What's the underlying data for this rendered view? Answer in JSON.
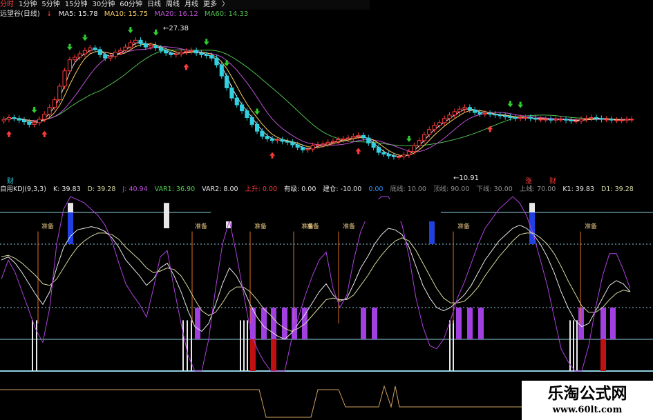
{
  "toolbar": {
    "tabs": [
      "分时",
      "1分钟",
      "5分钟",
      "15分钟",
      "30分钟",
      "60分钟",
      "日线",
      "周线",
      "月线",
      "更多",
      "〉"
    ],
    "active_index": 0
  },
  "stock_header": {
    "name": "远望谷(日线)",
    "ma5": "MA5: 15.78",
    "ma10": "MA10: 15.75",
    "ma20": "MA20: 16.12",
    "ma60": "MA60: 14.33",
    "up_arrow": "↑",
    "down_arrow": "↓"
  },
  "price_labels": {
    "high": "27.38",
    "low": "10.91",
    "tag_cai_left": "财",
    "tag_zhang": "涨",
    "tag_cai_right": "财"
  },
  "kdj_header": {
    "name": "自用KDJ(9,3,3)",
    "k": "K: 39.83",
    "d": "D: 39.28",
    "j": "J: 40.94",
    "var1": "VAR1: 36.90",
    "var2": "VAR2: 8.00",
    "shangsheng": "上升: 0.00",
    "youxi": "有级: 0.00",
    "jiancang": "建仓: -10.00",
    "zero": "0.00",
    "dixian": "底线: 10.00",
    "dingxian": "顶线: 90.00",
    "xiaxian": "下线: 30.00",
    "shangxian": "上线: 70.00",
    "k1": "K1: 39.83",
    "d1": "D1: 39.28"
  },
  "marker_text": "准备",
  "watermark": {
    "title": "乐淘公式网",
    "url": "www.60lt.com"
  },
  "colors": {
    "up": "#ff3c3c",
    "up_candle": "#ff3c3c",
    "down_candle": "#31d0e0",
    "ma5": "#e8e8e8",
    "ma10": "#ffd060",
    "ma20": "#c050d8",
    "ma60": "#50c050",
    "kdj_k": "#e8e8e8",
    "kdj_d": "#d8d8a0",
    "kdj_j": "#b040e0",
    "purple_bar": "#a040e0",
    "blue_bar": "#2040e0",
    "white_bar": "#e8e8e8",
    "red_bar": "#c01010",
    "orange": "#e07020",
    "level": "#90d0e0",
    "square_wave": "#d0a060"
  },
  "chart_data": [
    {
      "type": "candlestick",
      "title": "远望谷(日线)",
      "ylim": [
        10.0,
        28.5
      ],
      "x": [
        1,
        2,
        3,
        4,
        5,
        6,
        7,
        8,
        9,
        10,
        11,
        12,
        13,
        14,
        15,
        16,
        17,
        18,
        19,
        20,
        21,
        22,
        23,
        24,
        25,
        26,
        27,
        28,
        29,
        30,
        31,
        32,
        33,
        34,
        35,
        36,
        37,
        38,
        39,
        40,
        41,
        42,
        43,
        44,
        45,
        46,
        47,
        48,
        49,
        50,
        51,
        52,
        53,
        54,
        55,
        56,
        57,
        58,
        59,
        60,
        61,
        62,
        63,
        64,
        65,
        66,
        67,
        68,
        69,
        70,
        71,
        72,
        73,
        74,
        75,
        76,
        77,
        78,
        79,
        80,
        81,
        82,
        83,
        84,
        85,
        86,
        87,
        88,
        89,
        90,
        91,
        92,
        93,
        94,
        95,
        96,
        97,
        98,
        99,
        100,
        101,
        102,
        103,
        104,
        105,
        106,
        107,
        108,
        109,
        110,
        111,
        112,
        113,
        114,
        115,
        116,
        117,
        118,
        119,
        120,
        121,
        122,
        123,
        124,
        125
      ],
      "open": [
        16.7,
        16.9,
        17.1,
        17.0,
        16.8,
        16.6,
        16.3,
        16.5,
        16.9,
        17.5,
        18.3,
        19.2,
        20.8,
        22.6,
        23.9,
        24.2,
        24.6,
        25.0,
        25.3,
        25.1,
        24.5,
        24.1,
        24.3,
        24.8,
        25.0,
        25.4,
        25.9,
        26.2,
        25.8,
        25.4,
        25.6,
        25.3,
        25.0,
        24.7,
        24.5,
        24.6,
        24.8,
        24.9,
        25.0,
        24.7,
        24.5,
        24.4,
        24.1,
        23.3,
        22.0,
        20.6,
        19.4,
        18.6,
        17.9,
        17.1,
        16.3,
        15.5,
        14.9,
        14.6,
        14.4,
        14.5,
        14.3,
        14.2,
        13.9,
        13.6,
        13.3,
        13.4,
        13.8,
        13.9,
        14.0,
        14.2,
        14.3,
        14.5,
        14.6,
        14.7,
        14.9,
        15.0,
        14.7,
        14.1,
        13.6,
        13.0,
        12.8,
        12.6,
        12.5,
        12.5,
        12.7,
        13.1,
        13.8,
        14.4,
        15.1,
        15.7,
        16.2,
        16.5,
        17.0,
        17.4,
        17.8,
        18.1,
        18.3,
        18.0,
        17.7,
        17.5,
        17.6,
        17.5,
        17.4,
        17.3,
        17.2,
        17.1,
        17.0,
        17.1,
        17.1,
        17.0,
        16.9,
        16.9,
        16.9,
        16.8,
        16.9,
        16.9,
        16.8,
        16.7,
        16.7,
        16.9,
        17.0,
        17.1,
        17.0,
        16.9,
        16.9,
        16.8,
        16.8,
        16.8,
        16.9
      ],
      "close": [
        16.9,
        17.1,
        17.0,
        16.8,
        16.6,
        16.3,
        16.5,
        16.9,
        17.5,
        18.3,
        19.2,
        20.8,
        22.6,
        23.9,
        24.2,
        24.6,
        25.0,
        25.3,
        25.1,
        24.5,
        24.1,
        24.3,
        24.8,
        25.0,
        25.4,
        25.9,
        26.2,
        25.8,
        25.4,
        25.6,
        25.3,
        25.0,
        24.7,
        24.5,
        24.6,
        24.8,
        24.9,
        25.0,
        24.7,
        24.5,
        24.4,
        24.1,
        23.3,
        22.0,
        20.6,
        19.4,
        18.6,
        17.9,
        17.1,
        16.3,
        15.5,
        14.9,
        14.6,
        14.4,
        14.5,
        14.3,
        14.2,
        13.9,
        13.6,
        13.3,
        13.4,
        13.8,
        13.9,
        14.0,
        14.2,
        14.3,
        14.5,
        14.6,
        14.7,
        14.9,
        15.0,
        14.7,
        14.1,
        13.6,
        13.0,
        12.8,
        12.6,
        12.5,
        12.5,
        12.7,
        13.1,
        13.8,
        14.4,
        15.1,
        15.7,
        16.2,
        16.5,
        17.0,
        17.4,
        17.8,
        18.1,
        18.3,
        18.0,
        17.7,
        17.5,
        17.6,
        17.5,
        17.4,
        17.3,
        17.2,
        17.1,
        17.0,
        17.1,
        17.1,
        17.0,
        16.9,
        16.9,
        16.9,
        16.8,
        16.9,
        16.9,
        16.8,
        16.7,
        16.7,
        16.9,
        17.0,
        17.1,
        17.0,
        16.9,
        16.9,
        16.8,
        16.8,
        16.8,
        16.9,
        16.9
      ]
    },
    {
      "type": "line",
      "title": "自用KDJ(9,3,3)",
      "ylim": [
        -10,
        100
      ],
      "x": [
        0,
        10,
        20,
        30,
        40,
        50,
        60,
        70,
        80,
        90,
        100,
        110,
        120,
        130,
        140,
        150,
        160,
        170,
        180,
        190,
        200,
        210,
        220,
        230,
        240,
        250,
        260,
        270,
        280,
        290,
        300,
        310,
        320,
        330,
        340,
        350,
        360,
        370,
        380,
        390,
        400,
        410,
        420,
        430,
        440,
        450,
        460,
        470,
        480,
        490,
        500,
        510,
        520,
        530,
        540,
        550,
        560,
        570,
        580,
        590,
        600,
        610,
        620,
        630,
        640,
        650,
        660,
        670,
        680,
        690,
        700,
        710,
        720,
        730,
        740,
        750,
        760,
        770,
        780,
        790,
        800,
        810,
        820,
        830,
        840,
        850,
        860,
        870,
        880,
        890,
        900,
        910
      ],
      "series": [
        {
          "name": "K",
          "values": [
            60,
            62,
            58,
            52,
            45,
            38,
            32,
            40,
            55,
            68,
            75,
            79,
            80,
            81,
            80,
            78,
            74,
            68,
            60,
            55,
            50,
            44,
            48,
            55,
            58,
            50,
            40,
            28,
            18,
            15,
            20,
            32,
            45,
            55,
            50,
            42,
            32,
            24,
            18,
            15,
            12,
            10,
            14,
            20,
            26,
            33,
            40,
            45,
            38,
            34,
            36,
            45,
            55,
            62,
            70,
            76,
            80,
            79,
            76,
            68,
            56,
            44,
            36,
            30,
            28,
            30,
            34,
            38,
            44,
            52,
            60,
            66,
            72,
            76,
            80,
            82,
            80,
            76,
            70,
            62,
            52,
            40,
            30,
            22,
            18,
            20,
            28,
            36,
            44,
            47,
            45,
            40
          ]
        },
        {
          "name": "D",
          "values": [
            62,
            63,
            61,
            58,
            54,
            50,
            45,
            44,
            48,
            55,
            62,
            68,
            72,
            75,
            77,
            77,
            76,
            73,
            68,
            64,
            60,
            55,
            52,
            53,
            55,
            54,
            50,
            43,
            35,
            28,
            25,
            27,
            33,
            40,
            43,
            43,
            40,
            35,
            29,
            25,
            20,
            17,
            15,
            17,
            20,
            25,
            30,
            35,
            36,
            35,
            35,
            38,
            44,
            50,
            57,
            63,
            68,
            72,
            74,
            72,
            66,
            58,
            50,
            42,
            36,
            33,
            33,
            34,
            38,
            43,
            50,
            56,
            62,
            67,
            72,
            76,
            77,
            77,
            74,
            70,
            64,
            56,
            47,
            39,
            31,
            27,
            27,
            30,
            35,
            39,
            41,
            40
          ]
        },
        {
          "name": "J",
          "values": [
            48,
            60,
            52,
            40,
            28,
            16,
            8,
            30,
            70,
            92,
            100,
            98,
            96,
            92,
            88,
            82,
            72,
            58,
            45,
            38,
            32,
            24,
            42,
            62,
            66,
            42,
            20,
            0,
            -10,
            -10,
            10,
            42,
            70,
            85,
            64,
            40,
            16,
            4,
            -4,
            -10,
            -10,
            -10,
            10,
            24,
            38,
            50,
            60,
            65,
            42,
            30,
            38,
            60,
            78,
            88,
            96,
            100,
            100,
            92,
            82,
            62,
            36,
            18,
            6,
            4,
            10,
            22,
            36,
            46,
            58,
            70,
            80,
            86,
            92,
            96,
            100,
            96,
            88,
            76,
            60,
            44,
            24,
            4,
            -4,
            -10,
            -10,
            6,
            30,
            50,
            64,
            64,
            54,
            42
          ]
        }
      ]
    }
  ]
}
